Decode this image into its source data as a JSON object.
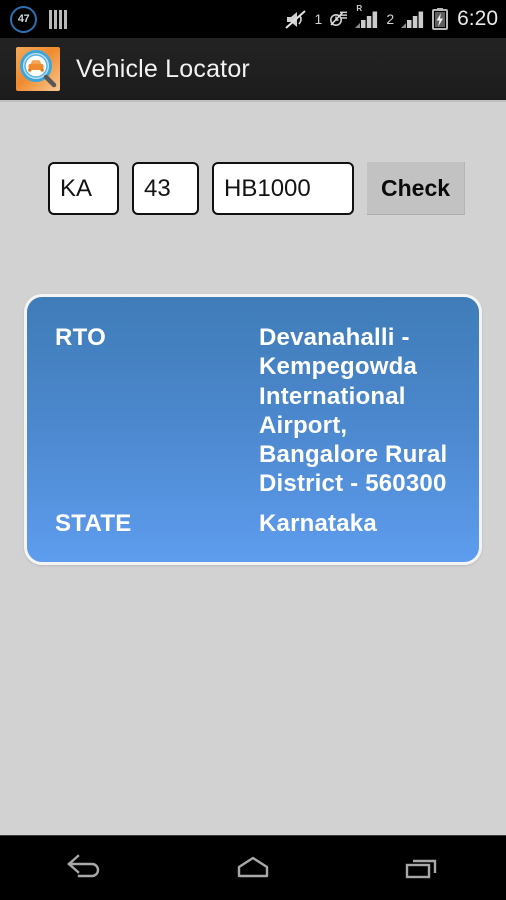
{
  "status_bar": {
    "notification_count": "47",
    "icons": [
      "notification-count-icon",
      "equalizer-bars-icon",
      "volume-muted-icon",
      "alarm-off-icon",
      "signal-bars-roaming-icon",
      "signal-bars-icon",
      "battery-charging-icon"
    ],
    "sim1_label": "1",
    "sim2_label": "2",
    "roaming_label": "R",
    "clock": "6:20"
  },
  "action_bar": {
    "app_icon": "vehicle-locator-app-icon",
    "title": "Vehicle Locator"
  },
  "search": {
    "state_code": "KA",
    "district_code": "43",
    "registration_number": "HB1000",
    "state_placeholder": "KA",
    "district_placeholder": "43",
    "number_placeholder": "HB1000",
    "check_label": "Check"
  },
  "result": {
    "rows": [
      {
        "label": "RTO",
        "value": "Devanahalli - Kempegowda International Airport, Bangalore Rural District - 560300"
      },
      {
        "label": "STATE",
        "value": "Karnataka"
      }
    ]
  },
  "nav_bar": {
    "back": "back-icon",
    "home": "home-icon",
    "recents": "recent-apps-icon"
  },
  "colors": {
    "screen_background": "#d2d2d2",
    "action_bar": "#1f1f1f",
    "card_top": "#3f7cb8",
    "card_bottom": "#5e9cee",
    "card_border": "#f4f4f4",
    "button": "#c2c2c2",
    "accent_orange": "#f08a2e",
    "badge_ring": "#2e6fb0"
  }
}
